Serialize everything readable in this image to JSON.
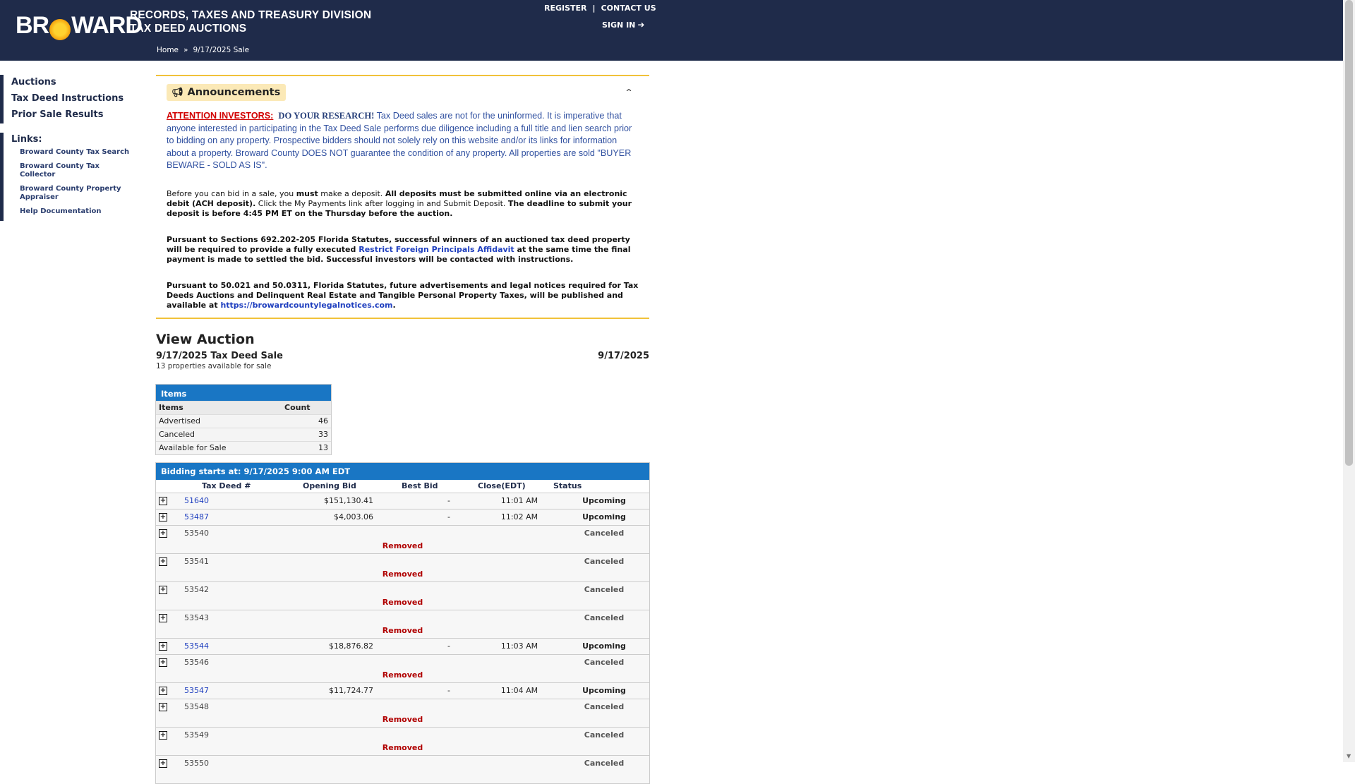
{
  "header": {
    "logo_left": "BR",
    "logo_right": "WARD",
    "division_line1": "RECORDS, TAXES AND TREASURY DIVISION",
    "division_line2": "TAX DEED AUCTIONS",
    "register": "REGISTER",
    "separator": "|",
    "contact": "CONTACT US",
    "signin": "SIGN IN",
    "breadcrumb_home": "Home",
    "breadcrumb_sep": "»",
    "breadcrumb_current": "9/17/2025 Sale"
  },
  "sidebar": {
    "nav": [
      "Auctions",
      "Tax Deed Instructions",
      "Prior Sale Results"
    ],
    "links_header": "Links:",
    "links": [
      "Broward County Tax Search",
      "Broward County Tax Collector",
      "Broward County Property Appraiser",
      "Help Documentation"
    ]
  },
  "announcements": {
    "title": "Announcements",
    "attention": "ATTENTION INVESTORS:",
    "research": "DO YOUR RESEARCH!",
    "p1_text": " Tax Deed sales are not for the uninformed. It is imperative that anyone interested in participating in the Tax Deed Sale performs due diligence including a full title and lien search prior to bidding on any property. Prospective bidders should not solely rely on this website and/or its links for information about a property. Broward County DOES NOT guarantee the condition of any property.  All properties are sold \"BUYER BEWARE - SOLD AS IS\".",
    "p2_a": "Before you can bid in a sale, you ",
    "p2_must": "must",
    "p2_b": " make a deposit. ",
    "p2_bold1": "All deposits must be submitted online via an electronic debit (ACH deposit).",
    "p2_c": " Click the My Payments link after logging in and Submit Deposit. ",
    "p2_bold2": "The deadline to submit your deposit is before 4:45 PM ET on the Thursday before the auction.",
    "p3_a": "Pursuant to Sections 692.202-205 Florida Statutes, successful winners of an auctioned tax deed property will be required to provide a fully executed ",
    "p3_link": "Restrict Foreign Principals Affidavit",
    "p3_b": " at the same time the final payment is made to settled the bid. Successful investors will be contacted with instructions.",
    "p4_a": "Pursuant to 50.021 and 50.0311, Florida Statutes, future advertisements and legal notices required for Tax Deeds Auctions and Delinquent Real Estate and Tangible Personal Property Taxes, will be published and available at ",
    "p4_link": "https://browardcountylegalnotices.com",
    "p4_b": "."
  },
  "auction": {
    "heading": "View Auction",
    "sale_name": "9/17/2025 Tax Deed Sale",
    "sale_date": "9/17/2025",
    "available_text": "13 properties available for sale"
  },
  "items_table": {
    "caption": "Items",
    "headers": [
      "Items",
      "Count"
    ],
    "rows": [
      {
        "label": "Advertised",
        "count": "46"
      },
      {
        "label": "Canceled",
        "count": "33"
      },
      {
        "label": "Available for Sale",
        "count": "13"
      }
    ]
  },
  "bids_table": {
    "caption": "Bidding starts at: 9/17/2025 9:00 AM EDT",
    "headers": [
      "Tax Deed #",
      "Opening Bid",
      "Best Bid",
      "Close(EDT)",
      "Status"
    ],
    "removed_label": "Removed",
    "rows": [
      {
        "deed": "51640",
        "opening": "$151,130.41",
        "best": "-",
        "close": "11:01 AM",
        "status": "Upcoming"
      },
      {
        "deed": "53487",
        "opening": "$4,003.06",
        "best": "-",
        "close": "11:02 AM",
        "status": "Upcoming"
      },
      {
        "deed": "53540",
        "status": "Canceled"
      },
      {
        "deed": "53541",
        "status": "Canceled"
      },
      {
        "deed": "53542",
        "status": "Canceled"
      },
      {
        "deed": "53543",
        "status": "Canceled"
      },
      {
        "deed": "53544",
        "opening": "$18,876.82",
        "best": "-",
        "close": "11:03 AM",
        "status": "Upcoming"
      },
      {
        "deed": "53546",
        "status": "Canceled"
      },
      {
        "deed": "53547",
        "opening": "$11,724.77",
        "best": "-",
        "close": "11:04 AM",
        "status": "Upcoming"
      },
      {
        "deed": "53548",
        "status": "Canceled"
      },
      {
        "deed": "53549",
        "status": "Canceled"
      },
      {
        "deed": "53550",
        "status": "Canceled"
      }
    ]
  }
}
